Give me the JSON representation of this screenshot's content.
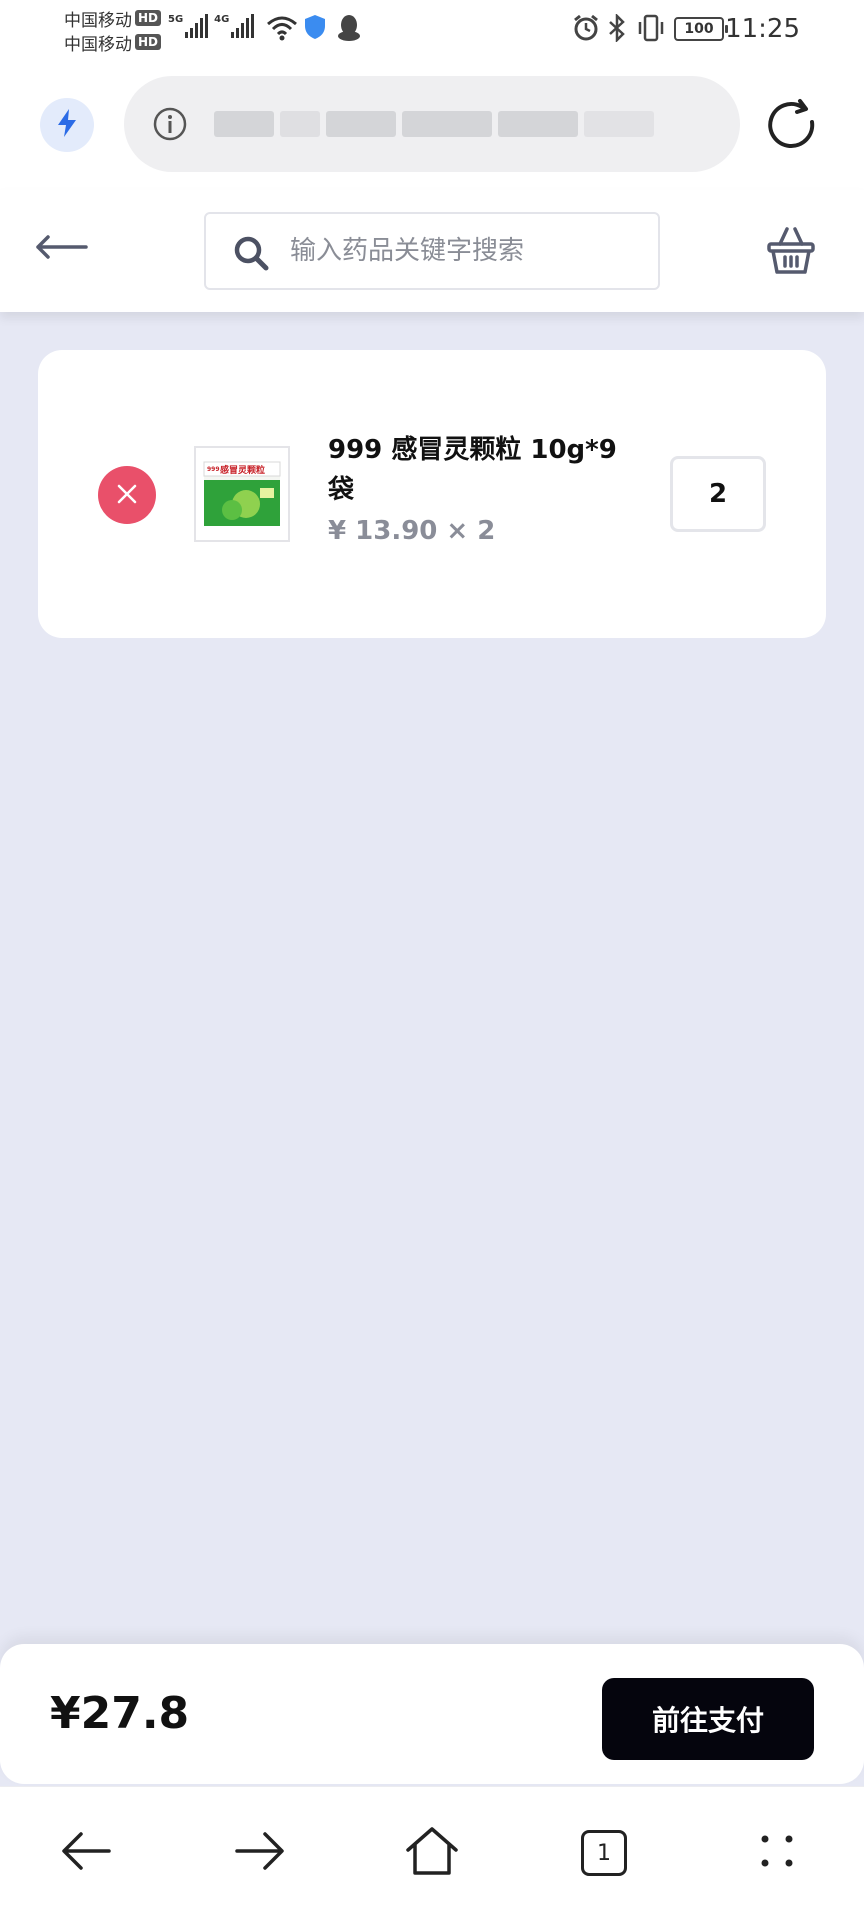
{
  "status_bar": {
    "carriers": [
      {
        "name": "中国移动",
        "badge": "HD"
      },
      {
        "name": "中国移动",
        "badge": "HD"
      }
    ],
    "network_tags": [
      "5G",
      "4G"
    ],
    "battery": "100",
    "time": "11:25"
  },
  "browser": {
    "url": "",
    "icons": [
      "bolt-icon",
      "info-icon",
      "reload-icon"
    ]
  },
  "header": {
    "search_placeholder": "输入药品关键字搜索",
    "icons": [
      "back-arrow-icon",
      "search-icon",
      "basket-icon"
    ]
  },
  "cart": {
    "items": [
      {
        "name": "999 感冒灵颗粒 10g*9袋",
        "price_line": "¥ 13.90 × 2",
        "quantity": "2",
        "thumb_label": "感冒灵颗粒",
        "thumb_brand": "999"
      }
    ]
  },
  "checkout": {
    "total": "¥27.8",
    "pay_label": "前往支付"
  },
  "nav": {
    "tab_count": "1",
    "icons": [
      "back-icon",
      "forward-icon",
      "home-icon",
      "tabs-icon",
      "menu-icon"
    ]
  },
  "colors": {
    "background": "#e6e8f4",
    "remove": "#e9506a",
    "pay_button": "#05050d",
    "bolt_accent": "#2b6be6"
  }
}
